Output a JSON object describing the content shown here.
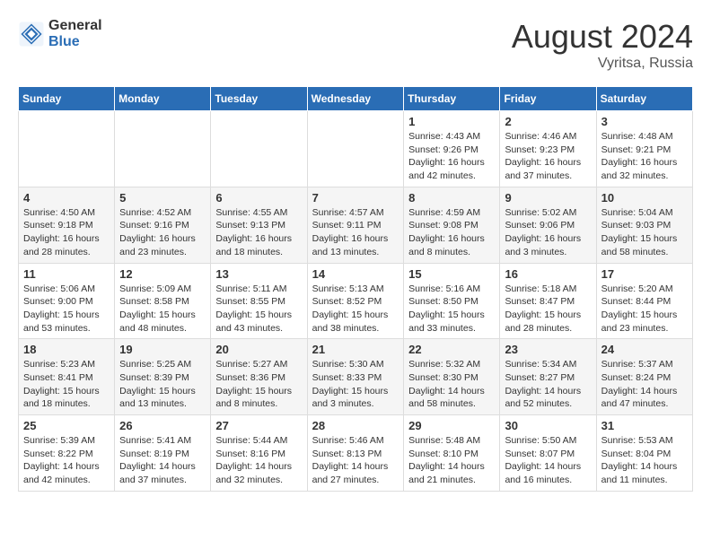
{
  "header": {
    "logo_general": "General",
    "logo_blue": "Blue",
    "month_year": "August 2024",
    "location": "Vyritsa, Russia"
  },
  "columns": [
    "Sunday",
    "Monday",
    "Tuesday",
    "Wednesday",
    "Thursday",
    "Friday",
    "Saturday"
  ],
  "weeks": [
    [
      {
        "day": "",
        "info": ""
      },
      {
        "day": "",
        "info": ""
      },
      {
        "day": "",
        "info": ""
      },
      {
        "day": "",
        "info": ""
      },
      {
        "day": "1",
        "info": "Sunrise: 4:43 AM\nSunset: 9:26 PM\nDaylight: 16 hours\nand 42 minutes."
      },
      {
        "day": "2",
        "info": "Sunrise: 4:46 AM\nSunset: 9:23 PM\nDaylight: 16 hours\nand 37 minutes."
      },
      {
        "day": "3",
        "info": "Sunrise: 4:48 AM\nSunset: 9:21 PM\nDaylight: 16 hours\nand 32 minutes."
      }
    ],
    [
      {
        "day": "4",
        "info": "Sunrise: 4:50 AM\nSunset: 9:18 PM\nDaylight: 16 hours\nand 28 minutes."
      },
      {
        "day": "5",
        "info": "Sunrise: 4:52 AM\nSunset: 9:16 PM\nDaylight: 16 hours\nand 23 minutes."
      },
      {
        "day": "6",
        "info": "Sunrise: 4:55 AM\nSunset: 9:13 PM\nDaylight: 16 hours\nand 18 minutes."
      },
      {
        "day": "7",
        "info": "Sunrise: 4:57 AM\nSunset: 9:11 PM\nDaylight: 16 hours\nand 13 minutes."
      },
      {
        "day": "8",
        "info": "Sunrise: 4:59 AM\nSunset: 9:08 PM\nDaylight: 16 hours\nand 8 minutes."
      },
      {
        "day": "9",
        "info": "Sunrise: 5:02 AM\nSunset: 9:06 PM\nDaylight: 16 hours\nand 3 minutes."
      },
      {
        "day": "10",
        "info": "Sunrise: 5:04 AM\nSunset: 9:03 PM\nDaylight: 15 hours\nand 58 minutes."
      }
    ],
    [
      {
        "day": "11",
        "info": "Sunrise: 5:06 AM\nSunset: 9:00 PM\nDaylight: 15 hours\nand 53 minutes."
      },
      {
        "day": "12",
        "info": "Sunrise: 5:09 AM\nSunset: 8:58 PM\nDaylight: 15 hours\nand 48 minutes."
      },
      {
        "day": "13",
        "info": "Sunrise: 5:11 AM\nSunset: 8:55 PM\nDaylight: 15 hours\nand 43 minutes."
      },
      {
        "day": "14",
        "info": "Sunrise: 5:13 AM\nSunset: 8:52 PM\nDaylight: 15 hours\nand 38 minutes."
      },
      {
        "day": "15",
        "info": "Sunrise: 5:16 AM\nSunset: 8:50 PM\nDaylight: 15 hours\nand 33 minutes."
      },
      {
        "day": "16",
        "info": "Sunrise: 5:18 AM\nSunset: 8:47 PM\nDaylight: 15 hours\nand 28 minutes."
      },
      {
        "day": "17",
        "info": "Sunrise: 5:20 AM\nSunset: 8:44 PM\nDaylight: 15 hours\nand 23 minutes."
      }
    ],
    [
      {
        "day": "18",
        "info": "Sunrise: 5:23 AM\nSunset: 8:41 PM\nDaylight: 15 hours\nand 18 minutes."
      },
      {
        "day": "19",
        "info": "Sunrise: 5:25 AM\nSunset: 8:39 PM\nDaylight: 15 hours\nand 13 minutes."
      },
      {
        "day": "20",
        "info": "Sunrise: 5:27 AM\nSunset: 8:36 PM\nDaylight: 15 hours\nand 8 minutes."
      },
      {
        "day": "21",
        "info": "Sunrise: 5:30 AM\nSunset: 8:33 PM\nDaylight: 15 hours\nand 3 minutes."
      },
      {
        "day": "22",
        "info": "Sunrise: 5:32 AM\nSunset: 8:30 PM\nDaylight: 14 hours\nand 58 minutes."
      },
      {
        "day": "23",
        "info": "Sunrise: 5:34 AM\nSunset: 8:27 PM\nDaylight: 14 hours\nand 52 minutes."
      },
      {
        "day": "24",
        "info": "Sunrise: 5:37 AM\nSunset: 8:24 PM\nDaylight: 14 hours\nand 47 minutes."
      }
    ],
    [
      {
        "day": "25",
        "info": "Sunrise: 5:39 AM\nSunset: 8:22 PM\nDaylight: 14 hours\nand 42 minutes."
      },
      {
        "day": "26",
        "info": "Sunrise: 5:41 AM\nSunset: 8:19 PM\nDaylight: 14 hours\nand 37 minutes."
      },
      {
        "day": "27",
        "info": "Sunrise: 5:44 AM\nSunset: 8:16 PM\nDaylight: 14 hours\nand 32 minutes."
      },
      {
        "day": "28",
        "info": "Sunrise: 5:46 AM\nSunset: 8:13 PM\nDaylight: 14 hours\nand 27 minutes."
      },
      {
        "day": "29",
        "info": "Sunrise: 5:48 AM\nSunset: 8:10 PM\nDaylight: 14 hours\nand 21 minutes."
      },
      {
        "day": "30",
        "info": "Sunrise: 5:50 AM\nSunset: 8:07 PM\nDaylight: 14 hours\nand 16 minutes."
      },
      {
        "day": "31",
        "info": "Sunrise: 5:53 AM\nSunset: 8:04 PM\nDaylight: 14 hours\nand 11 minutes."
      }
    ]
  ]
}
